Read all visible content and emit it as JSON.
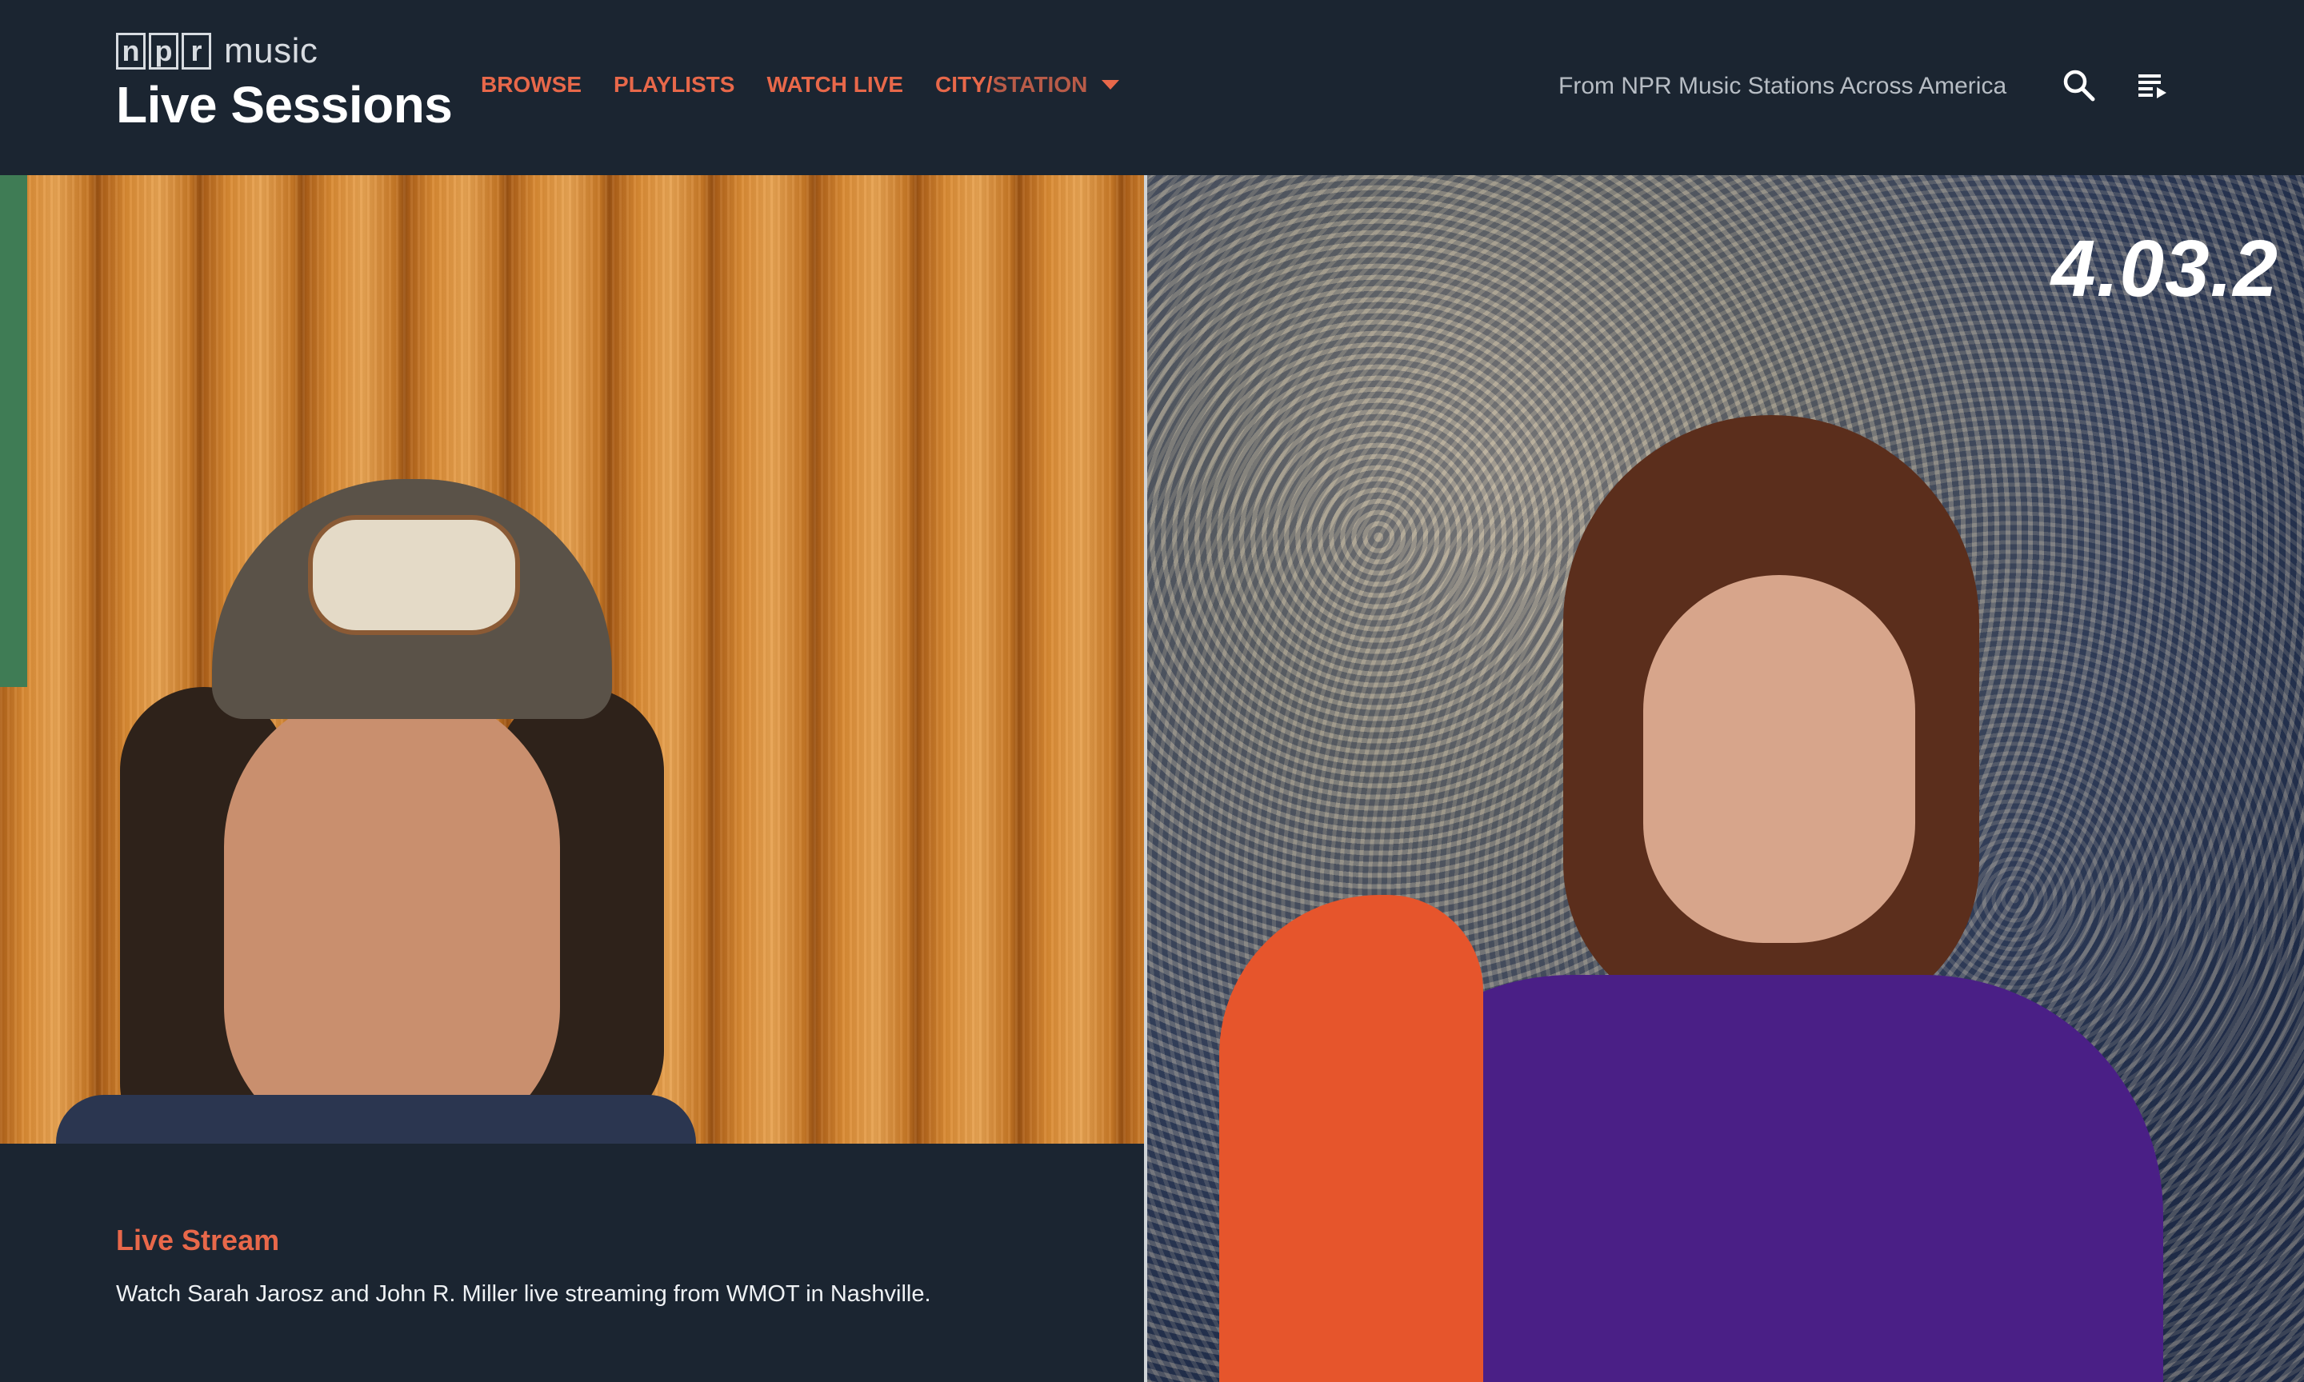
{
  "brand": {
    "npr_letters": [
      "n",
      "p",
      "r"
    ],
    "music": "music",
    "title": "Live Sessions"
  },
  "nav": {
    "items": [
      {
        "label": "BROWSE"
      },
      {
        "label": "PLAYLISTS"
      },
      {
        "label": "WATCH LIVE"
      }
    ],
    "city_prefix": "CITY/",
    "city_suffix": "STATION",
    "city_icon": "caret-down-icon"
  },
  "header": {
    "tagline": "From NPR Music Stations Across America",
    "search_icon": "search-icon",
    "queue_icon": "playlist-queue-icon"
  },
  "hero": {
    "date_overlay": "4.03.2",
    "kicker": "Live Stream",
    "description": "Watch Sarah Jarosz and John R. Miller live streaming from WMOT in Nashville."
  },
  "colors": {
    "background": "#1b2531",
    "accent": "#e8684a",
    "title": "#ffffff",
    "muted": "#b7bdc4"
  }
}
